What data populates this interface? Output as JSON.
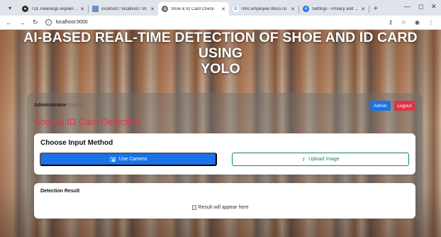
{
  "browser": {
    "tabs": [
      {
        "title": "TDL meanings explained",
        "favicon": "chat-icon",
        "color": "#2b2b2b",
        "active": false
      },
      {
        "title": "localhost / localhost / sh",
        "favicon": "database-icon",
        "color": "#6c8ebf",
        "active": false
      },
      {
        "title": "Shoe & ID Card Check",
        "favicon": "globe-icon",
        "color": "#5f6368",
        "active": true
      },
      {
        "title": "mnc employee dress co",
        "favicon": "google-icon",
        "color": "#4285f4",
        "active": false
      },
      {
        "title": "Settings - Privacy and se",
        "favicon": "gear-icon",
        "color": "#1a73e8",
        "active": false
      }
    ],
    "new_tab": "+",
    "address": "localhost:5000"
  },
  "page": {
    "hero_title_line1": "AI-BASED REAL-TIME DETECTION OF SHOE AND ID CARD USING",
    "hero_title_line2": "YOLO",
    "user_name": "Administrator",
    "user_role": "(Admin)",
    "admin_button": "Admin",
    "logout_button": "Logout",
    "section_heading": "Shoe & ID Card Detection",
    "input_method_title": "Choose Input Method",
    "use_camera_button": "Use Camera",
    "upload_image_button": "Upload Image",
    "detection_result_title": "Detection Result",
    "result_placeholder": "Result will appear here"
  },
  "colors": {
    "primary": "#1a73e8",
    "danger": "#dc3545",
    "success": "#198754",
    "heading": "#e03545"
  }
}
